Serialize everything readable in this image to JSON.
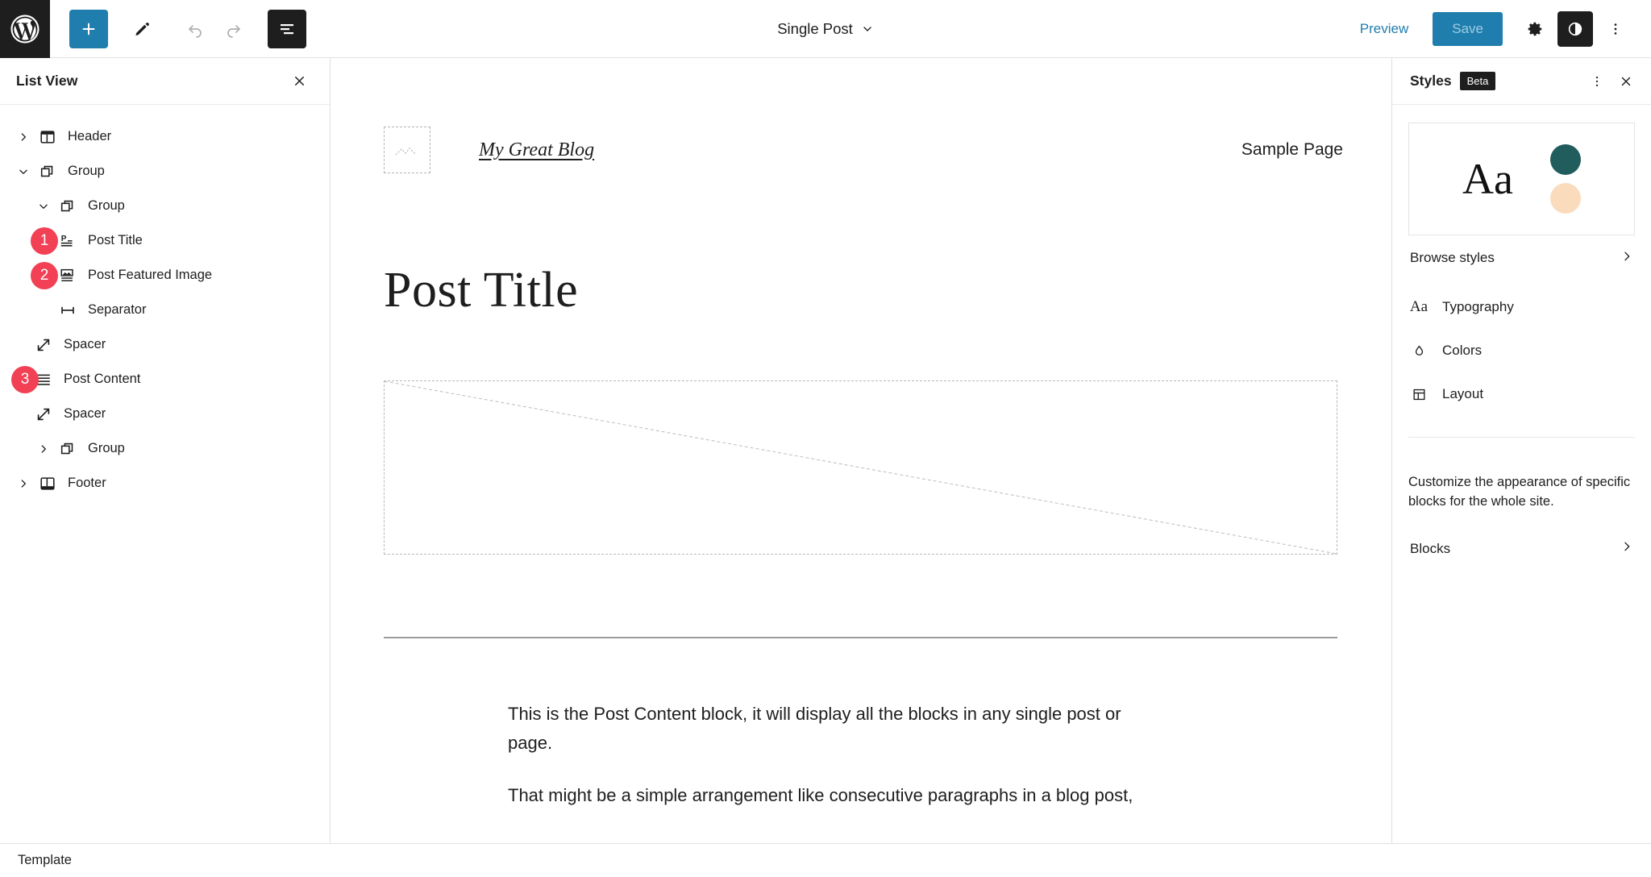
{
  "topbar": {
    "logo_icon": "wordpress-logo-icon",
    "tools": [
      {
        "name": "add-block-button",
        "icon": "plus-icon",
        "style": "primary"
      },
      {
        "name": "tools-edit-button",
        "icon": "pencil-icon",
        "style": "plain"
      },
      {
        "name": "undo-button",
        "icon": "undo-arrow-icon",
        "style": "disabled"
      },
      {
        "name": "redo-button",
        "icon": "redo-arrow-icon",
        "style": "disabled"
      },
      {
        "name": "list-view-button",
        "icon": "list-view-icon",
        "style": "dark"
      }
    ],
    "document_title": "Single Post",
    "document_title_chevron": "chevron-down-icon",
    "preview_label": "Preview",
    "save_label": "Save",
    "settings_icon": "gear-icon",
    "styles_icon": "contrast-half-circle-icon",
    "options_icon": "three-dots-vertical-icon",
    "accent_color": "#1f7ead"
  },
  "list_view": {
    "title": "List View",
    "close_icon": "close-x-icon",
    "items": [
      {
        "label": "Header",
        "icon": "header-layout-icon",
        "indent": 0,
        "chevron": "right",
        "badge": null
      },
      {
        "label": "Group",
        "icon": "group-stack-icon",
        "indent": 0,
        "chevron": "down",
        "badge": null
      },
      {
        "label": "Group",
        "icon": "group-stack-icon",
        "indent": 1,
        "chevron": "down",
        "badge": null
      },
      {
        "label": "Post Title",
        "icon": "post-title-icon",
        "indent": 2,
        "chevron": "none",
        "badge": "1"
      },
      {
        "label": "Post Featured Image",
        "icon": "featured-image-icon",
        "indent": 2,
        "chevron": "none",
        "badge": "2"
      },
      {
        "label": "Separator",
        "icon": "separator-icon",
        "indent": 2,
        "chevron": "none",
        "badge": null
      },
      {
        "label": "Spacer",
        "icon": "spacer-arrows-icon",
        "indent": 1,
        "chevron": "none",
        "badge": null
      },
      {
        "label": "Post Content",
        "icon": "post-content-lines-icon",
        "indent": 1,
        "chevron": "none",
        "badge": "3"
      },
      {
        "label": "Spacer",
        "icon": "spacer-arrows-icon",
        "indent": 1,
        "chevron": "none",
        "badge": null
      },
      {
        "label": "Group",
        "icon": "group-stack-icon",
        "indent": 1,
        "chevron": "right",
        "badge": null
      },
      {
        "label": "Footer",
        "icon": "footer-layout-icon",
        "indent": 0,
        "chevron": "right",
        "badge": null
      }
    ],
    "badge_color": "#f24055"
  },
  "canvas": {
    "site_logo_placeholder_icon": "image-placeholder-icon",
    "site_title": "My Great Blog",
    "nav_item": "Sample Page",
    "post_title": "Post Title",
    "featured_image_placeholder": "featured-image-placeholder",
    "paragraphs": [
      "This is the Post Content block, it will display all the blocks in any single post or page.",
      "That might be a simple arrangement like consecutive paragraphs in a blog post,"
    ]
  },
  "styles_panel": {
    "title": "Styles",
    "badge": "Beta",
    "more_icon": "three-dots-vertical-icon",
    "close_icon": "close-x-icon",
    "preview": {
      "sample_text": "Aa",
      "swatch_primary": "#215d5c",
      "swatch_secondary": "#fadcbd"
    },
    "browse_styles_label": "Browse styles",
    "browse_chevron": "chevron-right-icon",
    "menu": [
      {
        "label": "Typography",
        "icon": "typography-aa-icon"
      },
      {
        "label": "Colors",
        "icon": "color-drop-icon"
      },
      {
        "label": "Layout",
        "icon": "layout-grid-icon"
      }
    ],
    "description": "Customize the appearance of specific blocks for the whole site.",
    "blocks_label": "Blocks",
    "blocks_chevron": "chevron-right-icon"
  },
  "status_bar": {
    "label": "Template"
  }
}
